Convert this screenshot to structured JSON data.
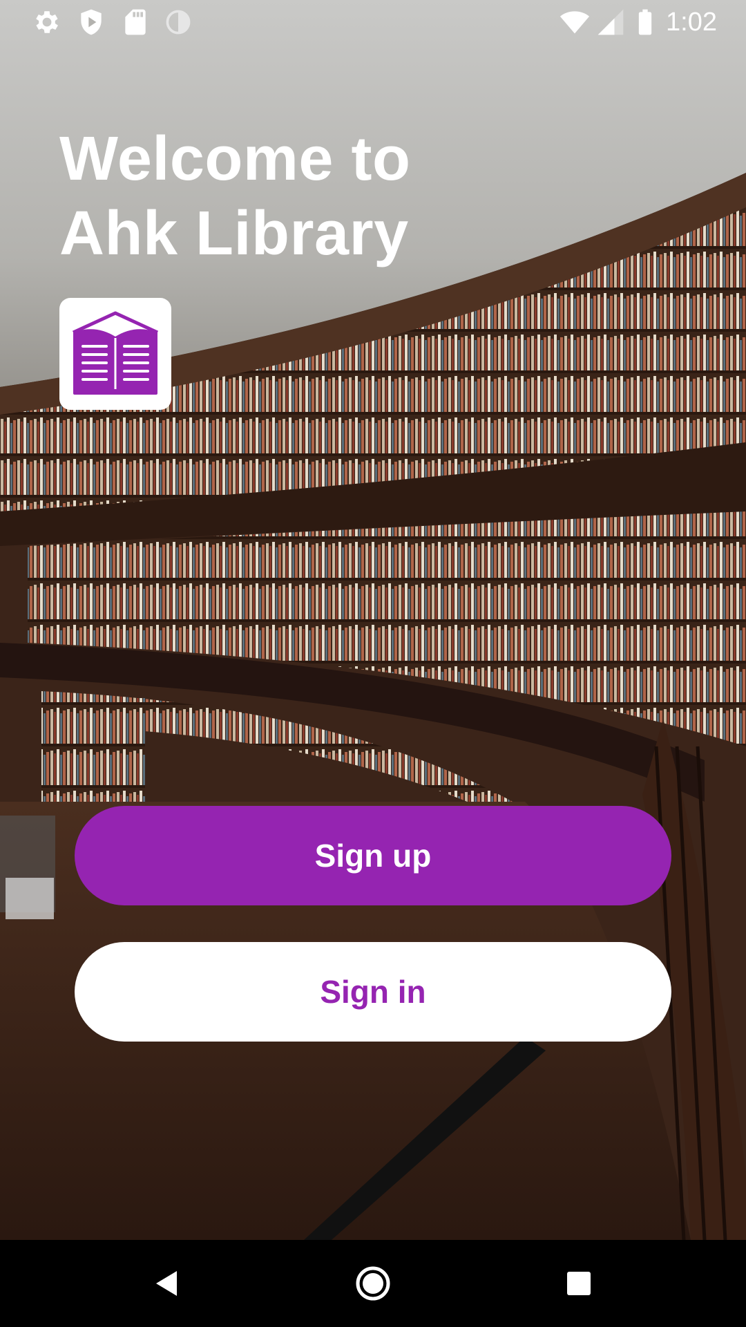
{
  "status_bar": {
    "time": "1:02",
    "left_icons": [
      "settings-icon",
      "shield-icon",
      "sd-card-icon",
      "sync-circle-icon"
    ],
    "right_icons": [
      "wifi-icon",
      "cell-signal-icon",
      "battery-icon"
    ]
  },
  "welcome": {
    "line1": "Welcome to",
    "line2": "Ahk Library"
  },
  "logo": {
    "icon": "open-book-icon",
    "color": "#9524b1"
  },
  "buttons": {
    "signup_label": "Sign up",
    "signin_label": "Sign in"
  },
  "colors": {
    "accent": "#9524b1",
    "button_text_light": "#ffffff"
  },
  "nav_bar": {
    "icons": [
      "back-icon",
      "home-icon",
      "recents-icon"
    ]
  }
}
